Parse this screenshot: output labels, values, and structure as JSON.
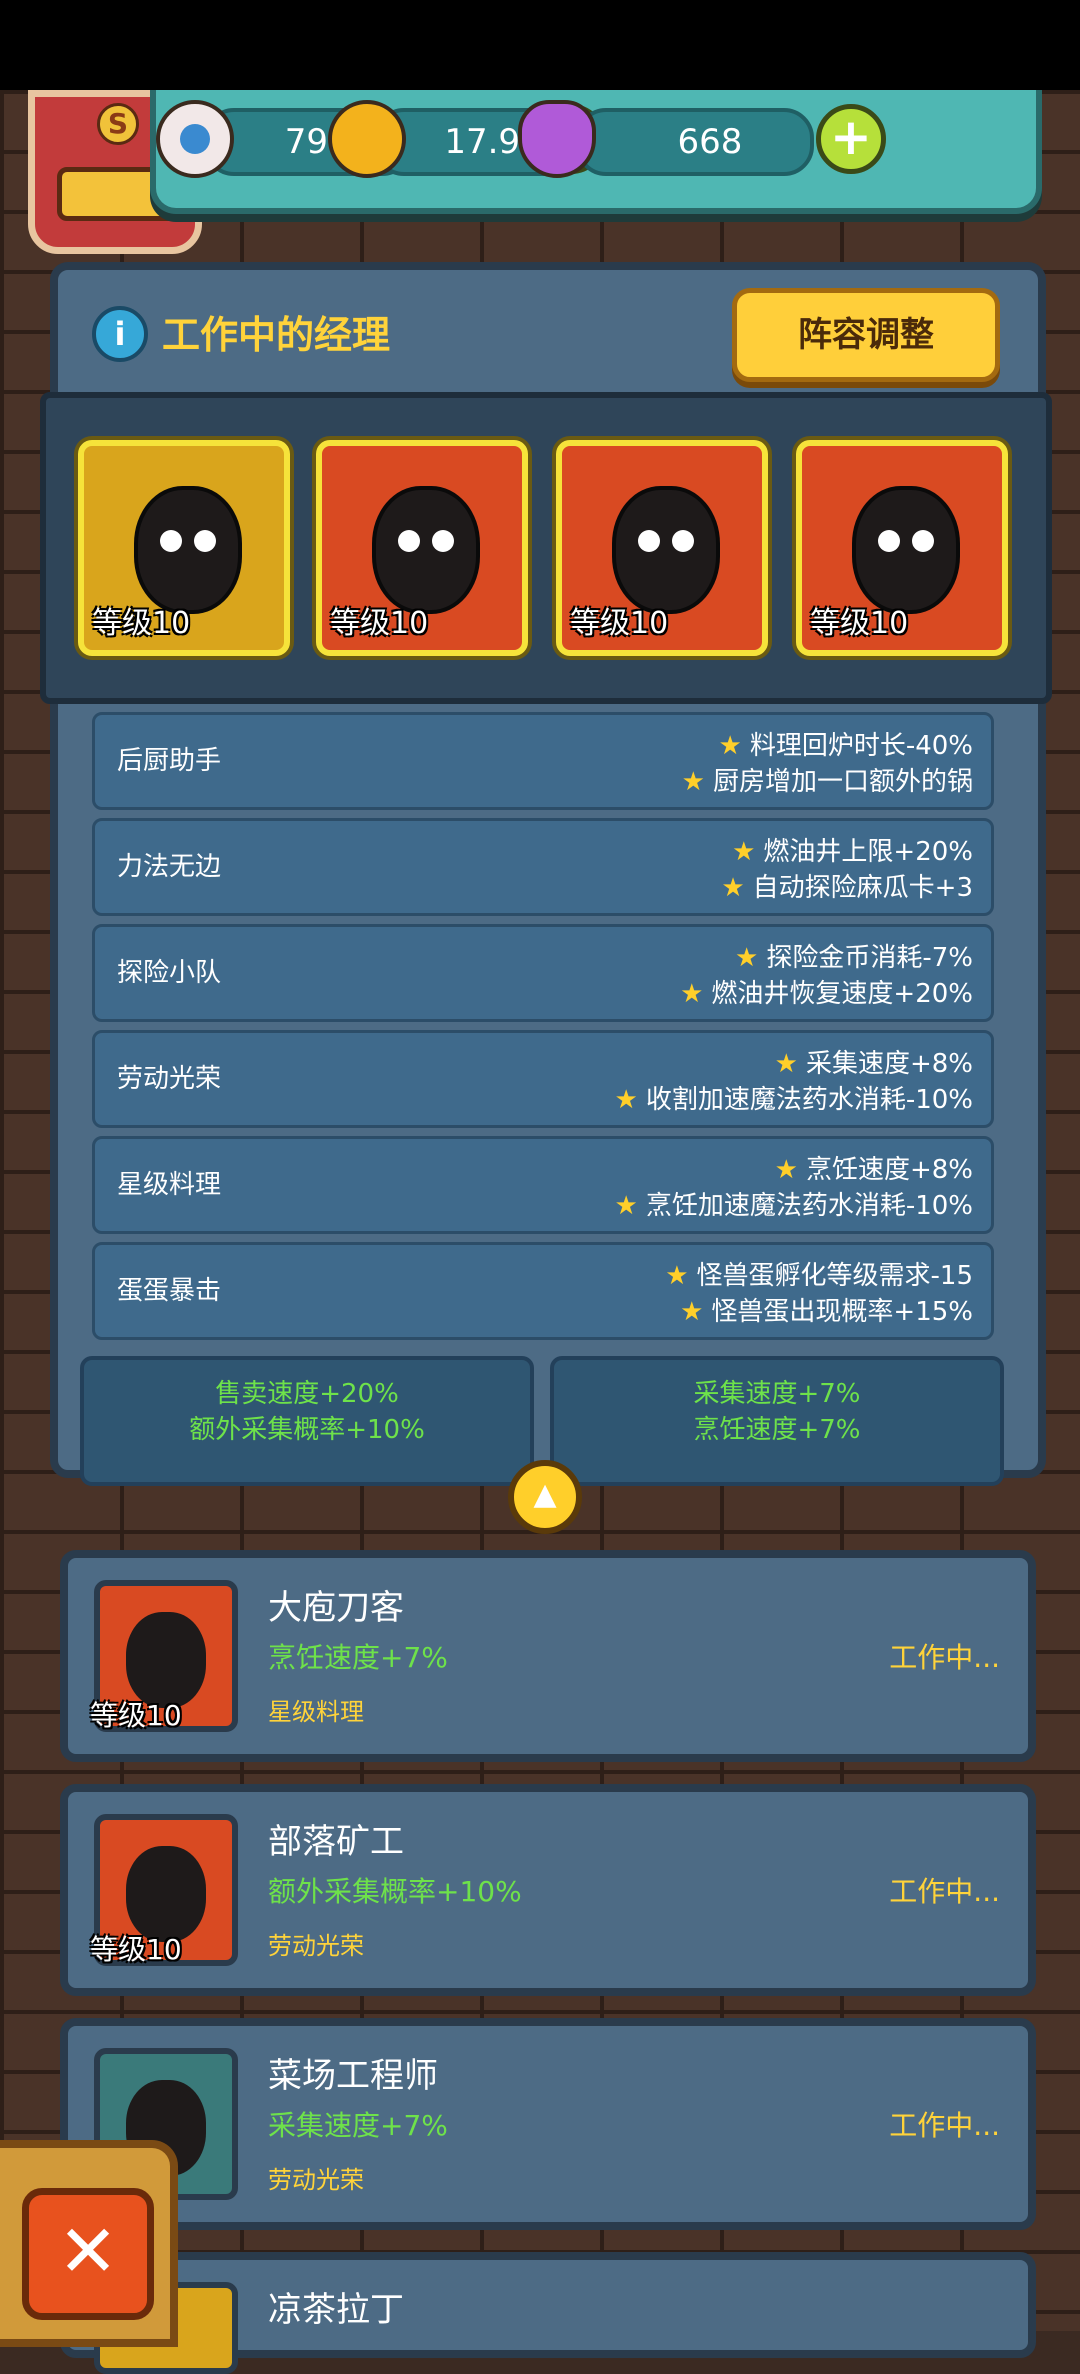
{
  "resources": {
    "eyeballs": "79m",
    "coins": "17.9b",
    "potions": "668",
    "plus": "+"
  },
  "badge": {
    "letter": "S"
  },
  "panel": {
    "title": "工作中的经理",
    "lineup_button": "阵容调整",
    "info": "i"
  },
  "managers": [
    {
      "level": "等级10",
      "color": "#d9a51c"
    },
    {
      "level": "等级10",
      "color": "#d94a22"
    },
    {
      "level": "等级10",
      "color": "#d94a22"
    },
    {
      "level": "等级10",
      "color": "#d94a22"
    }
  ],
  "skills": [
    {
      "name": "后厨助手",
      "effects": [
        "料理回炉时长-40%",
        "厨房增加一口额外的锅"
      ]
    },
    {
      "name": "力法无边",
      "effects": [
        "燃油井上限+20%",
        "自动探险麻瓜卡+3"
      ]
    },
    {
      "name": "探险小队",
      "effects": [
        "探险金币消耗-7%",
        "燃油井恢复速度+20%"
      ]
    },
    {
      "name": "劳动光荣",
      "effects": [
        "采集速度+8%",
        "收割加速魔法药水消耗-10%"
      ]
    },
    {
      "name": "星级料理",
      "effects": [
        "烹饪速度+8%",
        "烹饪加速魔法药水消耗-10%"
      ]
    },
    {
      "name": "蛋蛋暴击",
      "effects": [
        "怪兽蛋孵化等级需求-15",
        "怪兽蛋出现概率+15%"
      ]
    }
  ],
  "bonuses": {
    "left": [
      "售卖速度+20%",
      "额外采集概率+10%"
    ],
    "right": [
      "采集速度+7%",
      "烹饪速度+7%"
    ]
  },
  "collapse_icon": "▲",
  "workers": [
    {
      "name": "大庖刀客",
      "bonus": "烹饪速度+7%",
      "skill": "星级料理",
      "status": "工作中...",
      "level": "等级10"
    },
    {
      "name": "部落矿工",
      "bonus": "额外采集概率+10%",
      "skill": "劳动光荣",
      "status": "工作中...",
      "level": "等级10"
    },
    {
      "name": "菜场工程师",
      "bonus": "采集速度+7%",
      "skill": "劳动光荣",
      "status": "工作中...",
      "level": "等级10"
    },
    {
      "name": "凉茶拉丁",
      "bonus": "",
      "skill": "",
      "status": "",
      "level": ""
    }
  ],
  "close_label": "✕"
}
